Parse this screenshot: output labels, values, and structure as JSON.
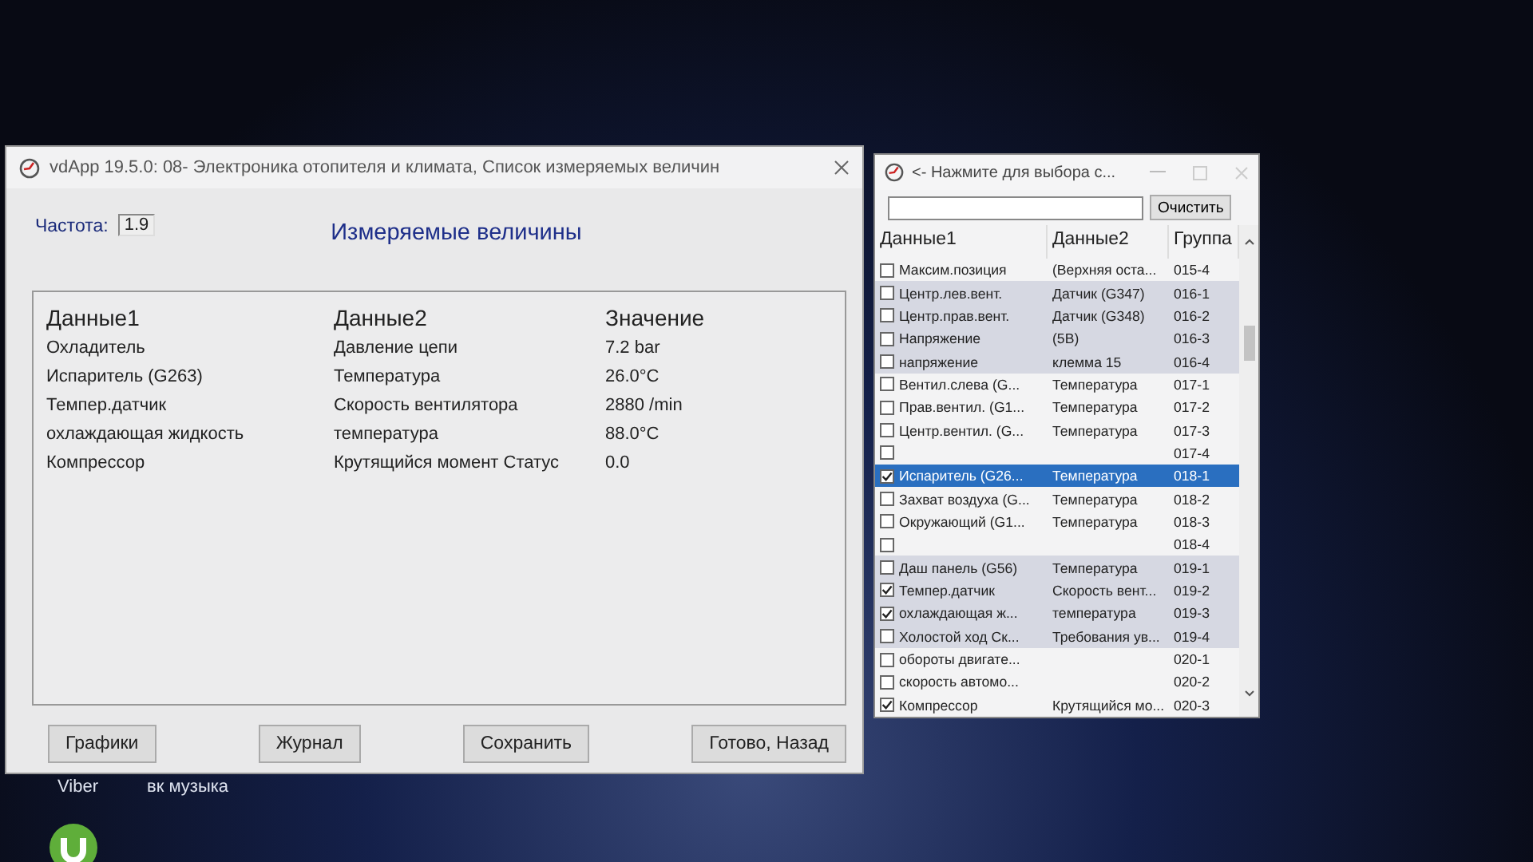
{
  "main_window": {
    "title": "vdApp 19.5.0: 08- Электроника отопителя и климата,  Список измеряемых величин",
    "frequency_label": "Частота:",
    "frequency_value": "1.9",
    "heading": "Измеряемые величины",
    "table": {
      "columns": [
        "Данные1",
        "Данные2",
        "Значение"
      ],
      "rows": [
        [
          "Охладитель",
          "Давление цепи",
          "7.2 bar"
        ],
        [
          "Испаритель (G263)",
          "Температура",
          "26.0°C"
        ],
        [
          "Темпер.датчик",
          "Скорость вентилятора",
          "2880 /min"
        ],
        [
          "охлаждающая жидкость",
          "температура",
          "88.0°C"
        ],
        [
          "Компрессор",
          "Крутящийся момент Статус",
          "0.0"
        ]
      ]
    },
    "buttons": [
      "Графики",
      "Журнал",
      "Сохранить",
      "Готово, Назад"
    ]
  },
  "picker_window": {
    "title": "<- Нажмите для выбора с...",
    "clear_button": "Очистить",
    "columns": [
      "Данные1",
      "Данные2",
      "Группа"
    ],
    "rows": [
      {
        "data1": "Максим.позиция",
        "data2": "(Верхняя оста...",
        "group": "015-4",
        "checked": false,
        "selected": false,
        "shaded": false
      },
      {
        "data1": "Центр.лев.вент.",
        "data2": "Датчик (G347)",
        "group": "016-1",
        "checked": false,
        "selected": false,
        "shaded": true
      },
      {
        "data1": "Центр.прав.вент.",
        "data2": "Датчик (G348)",
        "group": "016-2",
        "checked": false,
        "selected": false,
        "shaded": true
      },
      {
        "data1": "Напряжение",
        "data2": "(5В)",
        "group": "016-3",
        "checked": false,
        "selected": false,
        "shaded": true
      },
      {
        "data1": "напряжение",
        "data2": "клемма 15",
        "group": "016-4",
        "checked": false,
        "selected": false,
        "shaded": true
      },
      {
        "data1": "Вентил.слева (G...",
        "data2": "Температура",
        "group": "017-1",
        "checked": false,
        "selected": false,
        "shaded": false
      },
      {
        "data1": "Прав.вентил. (G1...",
        "data2": "Температура",
        "group": "017-2",
        "checked": false,
        "selected": false,
        "shaded": false
      },
      {
        "data1": "Центр.вентил. (G...",
        "data2": "Температура",
        "group": "017-3",
        "checked": false,
        "selected": false,
        "shaded": false
      },
      {
        "data1": "",
        "data2": "",
        "group": "017-4",
        "checked": false,
        "selected": false,
        "shaded": false
      },
      {
        "data1": "Испаритель (G26...",
        "data2": "Температура",
        "group": "018-1",
        "checked": true,
        "selected": true,
        "shaded": false
      },
      {
        "data1": "Захват воздуха (G...",
        "data2": "Температура",
        "group": "018-2",
        "checked": false,
        "selected": false,
        "shaded": false
      },
      {
        "data1": "Окружающий (G1...",
        "data2": "Температура",
        "group": "018-3",
        "checked": false,
        "selected": false,
        "shaded": false
      },
      {
        "data1": "",
        "data2": "",
        "group": "018-4",
        "checked": false,
        "selected": false,
        "shaded": false
      },
      {
        "data1": "Даш панель (G56)",
        "data2": "Температура",
        "group": "019-1",
        "checked": false,
        "selected": false,
        "shaded": true
      },
      {
        "data1": "Темпер.датчик",
        "data2": "Скорость вент...",
        "group": "019-2",
        "checked": true,
        "selected": false,
        "shaded": true
      },
      {
        "data1": "охлаждающая ж...",
        "data2": "температура",
        "group": "019-3",
        "checked": true,
        "selected": false,
        "shaded": true
      },
      {
        "data1": "Холостой ход Ск...",
        "data2": "Требования ув...",
        "group": "019-4",
        "checked": false,
        "selected": false,
        "shaded": true
      },
      {
        "data1": "обороты двигате...",
        "data2": "",
        "group": "020-1",
        "checked": false,
        "selected": false,
        "shaded": false
      },
      {
        "data1": "скорость автомо...",
        "data2": "",
        "group": "020-2",
        "checked": false,
        "selected": false,
        "shaded": false
      },
      {
        "data1": "Компрессор",
        "data2": "Крутящийся мо...",
        "group": "020-3",
        "checked": true,
        "selected": false,
        "shaded": false
      }
    ]
  },
  "desktop_icons": [
    "Viber",
    "вк музыка"
  ]
}
